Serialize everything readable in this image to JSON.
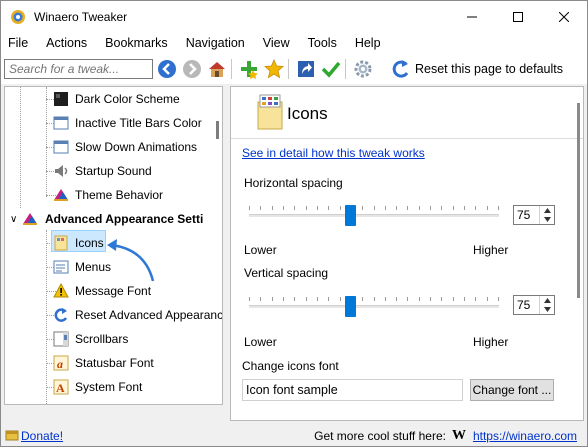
{
  "window": {
    "title": "Winaero Tweaker"
  },
  "menu": [
    "File",
    "Actions",
    "Bookmarks",
    "Navigation",
    "View",
    "Tools",
    "Help"
  ],
  "toolbar": {
    "search_placeholder": "Search for a tweak...",
    "reset_label": "Reset this page to defaults"
  },
  "tree": {
    "items": [
      {
        "label": "Dark Color Scheme",
        "icon": "dark-scheme-icon"
      },
      {
        "label": "Inactive Title Bars Color",
        "icon": "window-icon"
      },
      {
        "label": "Slow Down Animations",
        "icon": "window-icon"
      },
      {
        "label": "Startup Sound",
        "icon": "speaker-icon"
      },
      {
        "label": "Theme Behavior",
        "icon": "theme-icon"
      },
      {
        "label": "Advanced Appearance Setti",
        "icon": "theme-icon",
        "group": true
      },
      {
        "label": "Icons",
        "icon": "icons-icon",
        "selected": true
      },
      {
        "label": "Menus",
        "icon": "menus-icon"
      },
      {
        "label": "Message Font",
        "icon": "warning-icon"
      },
      {
        "label": "Reset Advanced Appearance",
        "icon": "reset-icon"
      },
      {
        "label": "Scrollbars",
        "icon": "scrollbars-icon"
      },
      {
        "label": "Statusbar Font",
        "icon": "font-icon"
      },
      {
        "label": "System Font",
        "icon": "font-icon"
      }
    ]
  },
  "panel": {
    "title": "Icons",
    "detail_link": "See in detail how this tweak works",
    "horizontal": {
      "label": "Horizontal spacing",
      "value": "75",
      "level": 0.4,
      "min_label": "Lower",
      "max_label": "Higher"
    },
    "vertical": {
      "label": "Vertical spacing",
      "value": "75",
      "level": 0.4,
      "min_label": "Lower",
      "max_label": "Higher"
    },
    "font_label": "Change icons font",
    "font_sample": "Icon font sample",
    "font_button": "Change font ..."
  },
  "status": {
    "donate": "Donate!",
    "promo": "Get more cool stuff here:",
    "logo_letter": "W",
    "site": "https://winaero.com"
  },
  "colors": {
    "accent": "#0078d7",
    "link": "#0033cc",
    "selection": "#cce8ff"
  }
}
